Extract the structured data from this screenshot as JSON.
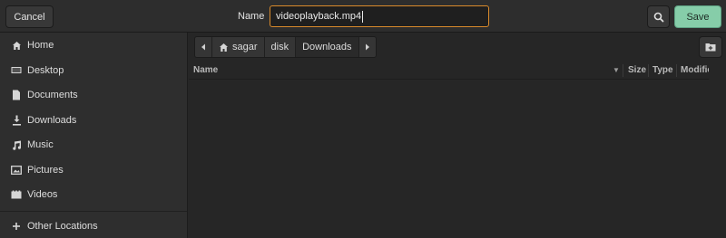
{
  "header": {
    "cancel_label": "Cancel",
    "name_label": "Name",
    "filename_value": "videoplayback.mp4",
    "search_icon": "search-icon",
    "save_label": "Save",
    "accent_color": "#d98a2b",
    "save_color": "#86cda9"
  },
  "sidebar": {
    "items": [
      {
        "label": "Home",
        "icon": "home-icon"
      },
      {
        "label": "Desktop",
        "icon": "desktop-icon"
      },
      {
        "label": "Documents",
        "icon": "document-icon"
      },
      {
        "label": "Downloads",
        "icon": "download-icon"
      },
      {
        "label": "Music",
        "icon": "music-icon"
      },
      {
        "label": "Pictures",
        "icon": "pictures-icon"
      },
      {
        "label": "Videos",
        "icon": "videos-icon"
      }
    ],
    "other_locations": {
      "label": "Other Locations",
      "icon": "plus-icon"
    }
  },
  "pathbar": {
    "segments": [
      "sagar",
      "disk",
      "Downloads"
    ],
    "active_segment": "Downloads"
  },
  "columns": {
    "name": "Name",
    "size": "Size",
    "type": "Type",
    "modified": "Modified"
  }
}
